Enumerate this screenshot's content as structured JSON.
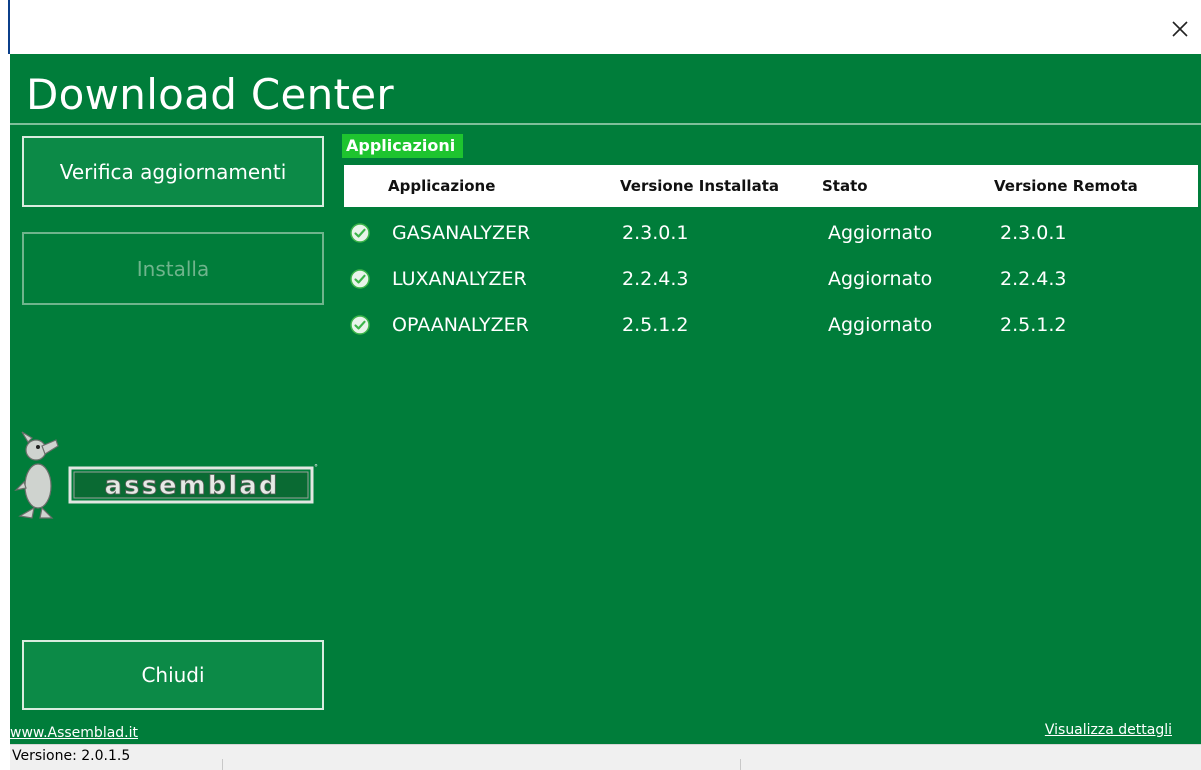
{
  "window": {
    "close_icon": "close-icon"
  },
  "header": {
    "title": "Download Center"
  },
  "sidebar": {
    "verify_label": "Verifica aggiornamenti",
    "install_label": "Installa",
    "close_label": "Chiudi"
  },
  "section": {
    "label": "Applicazioni"
  },
  "table": {
    "columns": [
      "Applicazione",
      "Versione Installata",
      "Stato",
      "Versione Remota"
    ],
    "rows": [
      {
        "icon": "check-circle-icon",
        "name": "GASANALYZER",
        "installed": "2.3.0.1",
        "status": "Aggiornato",
        "remote": "2.3.0.1"
      },
      {
        "icon": "check-circle-icon",
        "name": "LUXANALYZER",
        "installed": "2.2.4.3",
        "status": "Aggiornato",
        "remote": "2.2.4.3"
      },
      {
        "icon": "check-circle-icon",
        "name": "OPAANALYZER",
        "installed": "2.5.1.2",
        "status": "Aggiornato",
        "remote": "2.5.1.2"
      }
    ]
  },
  "logo": {
    "text": "assemblad"
  },
  "footer": {
    "site_link": "www.Assemblad.it",
    "details_link": "Visualizza dettagli"
  },
  "statusbar": {
    "version": "Versione: 2.0.1.5"
  },
  "colors": {
    "background": "#007d3a",
    "button": "#0c8a47",
    "section_label": "#1ec42f",
    "check": "#3cb54a"
  }
}
